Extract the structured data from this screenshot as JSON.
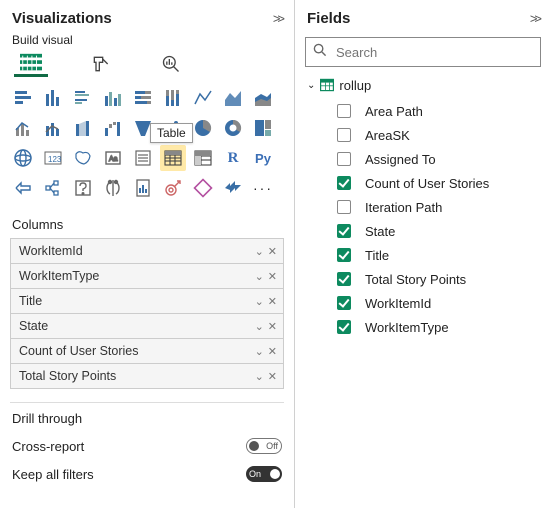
{
  "visualizations": {
    "title": "Visualizations",
    "subtitle": "Build visual",
    "tooltip_table": "Table",
    "columns_label": "Columns",
    "columns": [
      "WorkItemId",
      "WorkItemType",
      "Title",
      "State",
      "Count of User Stories",
      "Total Story Points"
    ],
    "drill_label": "Drill through",
    "cross_report_label": "Cross-report",
    "cross_report_state": "Off",
    "keep_filters_label": "Keep all filters",
    "keep_filters_state": "On"
  },
  "fields": {
    "title": "Fields",
    "search_placeholder": "Search",
    "table": {
      "name": "rollup",
      "items": [
        {
          "label": "Area Path",
          "checked": false
        },
        {
          "label": "AreaSK",
          "checked": false
        },
        {
          "label": "Assigned To",
          "checked": false
        },
        {
          "label": "Count of User Stories",
          "checked": true
        },
        {
          "label": "Iteration Path",
          "checked": false
        },
        {
          "label": "State",
          "checked": true
        },
        {
          "label": "Title",
          "checked": true
        },
        {
          "label": "Total Story Points",
          "checked": true
        },
        {
          "label": "WorkItemId",
          "checked": true
        },
        {
          "label": "WorkItemType",
          "checked": true
        }
      ]
    }
  },
  "viz_gallery": [
    "stacked-bar",
    "stacked-column",
    "clustered-bar",
    "clustered-column",
    "100-bar",
    "100-column",
    "line",
    "area",
    "stacked-area",
    "line-col",
    "line-col2",
    "ribbon",
    "waterfall",
    "funnel",
    "scatter",
    "pie",
    "donut",
    "treemap",
    "map",
    "filled-map",
    "azure-map",
    "gauge",
    "card",
    "multi-card",
    "kpi",
    "slicer",
    "table",
    "matrix",
    "r-visual",
    "py-visual",
    "key-influencer",
    "decomp",
    "qna",
    "narrative",
    "paginated",
    "goals",
    "arc",
    "more"
  ]
}
